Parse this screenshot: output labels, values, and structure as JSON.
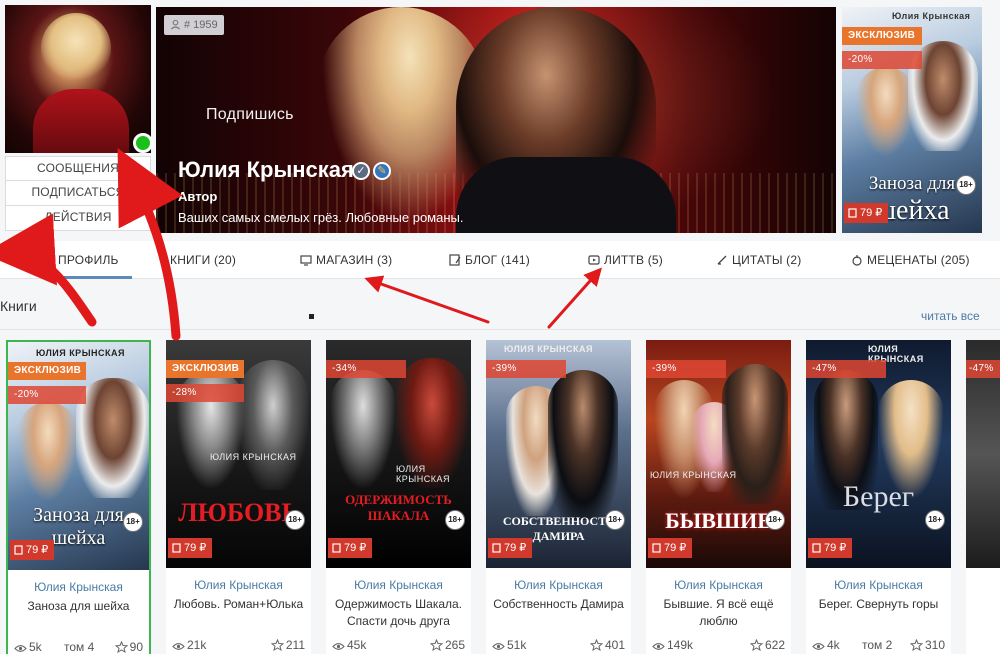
{
  "profile": {
    "member_number": "# 1959",
    "subscribe_overlay": "Подпишись",
    "author_name": "Юлия Крынская",
    "role": "Автор",
    "motto": "Ваших самых смелых грёз. Любовные романы.",
    "buttons": {
      "messages": "СООБЩЕНИЯ",
      "subscribe": "ПОДПИСАТЬСЯ",
      "actions": "ДЕЙСТВИЯ"
    }
  },
  "featured_book": {
    "badge_exclusive": "ЭКСКЛЮЗИВ",
    "discount": "-20%",
    "price": "79 ₽",
    "age": "18+",
    "cover_author": "Юлия Крынская",
    "cover_title_1": "Заноза для",
    "cover_title_2": "шейха"
  },
  "tabs": [
    {
      "label": "ПРОФИЛЬ",
      "icon": "profile-icon"
    },
    {
      "label": "КНИГИ (20)",
      "icon": "book-icon"
    },
    {
      "label": "МАГАЗИН (3)",
      "icon": "shop-icon"
    },
    {
      "label": "БЛОГ (141)",
      "icon": "blog-icon"
    },
    {
      "label": "ЛИТТВ (5)",
      "icon": "video-icon"
    },
    {
      "label": "ЦИТАТЫ (2)",
      "icon": "quote-icon"
    },
    {
      "label": "МЕЦЕНАТЫ (205)",
      "icon": "patron-icon"
    }
  ],
  "books_section": {
    "title": "Книги",
    "read_all": "читать все"
  },
  "books": [
    {
      "author": "Юлия Крынская",
      "title": "Заноза для шейха",
      "badge": "ЭКСКЛЮЗИВ",
      "discount": "-20%",
      "price": "79 ₽",
      "age": "18+",
      "views": "5k",
      "volume": "том 4",
      "rating": "90",
      "cover_text": "Заноза для шейха",
      "cover_author": "ЮЛИЯ КРЫНСКАЯ"
    },
    {
      "author": "Юлия Крынская",
      "title": "Любовь. Роман+Юлька",
      "badge": "ЭКСКЛЮЗИВ",
      "discount": "-28%",
      "price": "79 ₽",
      "age": "18+",
      "views": "21k",
      "volume": "",
      "rating": "211",
      "cover_text": "ЛЮБОВЬ",
      "cover_author": "ЮЛИЯ КРЫНСКАЯ"
    },
    {
      "author": "Юлия Крынская",
      "title": "Одержимость Шакала. Спасти дочь друга",
      "badge": "",
      "discount": "-34%",
      "price": "79 ₽",
      "age": "18+",
      "views": "45k",
      "volume": "",
      "rating": "265",
      "cover_text": "ОДЕРЖИМОСТЬ ШАКАЛА",
      "cover_author": "ЮЛИЯ КРЫНСКАЯ"
    },
    {
      "author": "Юлия Крынская",
      "title": "Собственность Дамира",
      "badge": "",
      "discount": "-39%",
      "price": "79 ₽",
      "age": "18+",
      "views": "51k",
      "volume": "",
      "rating": "401",
      "cover_text": "СОБСТВЕННОСТЬ ДАМИРА",
      "cover_author": "ЮЛИЯ КРЫНСКАЯ"
    },
    {
      "author": "Юлия Крынская",
      "title": "Бывшие. Я всё ещё люблю",
      "badge": "",
      "discount": "-39%",
      "price": "79 ₽",
      "age": "18+",
      "views": "149k",
      "volume": "",
      "rating": "622",
      "cover_text": "БЫВШИЕ",
      "cover_author": "ЮЛИЯ КРЫНСКАЯ"
    },
    {
      "author": "Юлия Крынская",
      "title": "Берег. Свернуть горы",
      "badge": "",
      "discount": "-47%",
      "price": "79 ₽",
      "age": "18+",
      "views": "4k",
      "volume": "том 2",
      "rating": "310",
      "cover_text": "Берег",
      "cover_author": "ЮЛИЯ КРЫНСКАЯ"
    },
    {
      "author": "",
      "title": "",
      "badge": "",
      "discount": "-47%",
      "price": "",
      "age": "",
      "views": "",
      "volume": "",
      "rating": "",
      "cover_text": "",
      "cover_author": ""
    }
  ],
  "colors": {
    "accent_link": "#4a7ba7",
    "exclusive_badge": "#e9742b",
    "discount_badge": "#de4632",
    "price_badge": "#d0392b",
    "online": "#1bc11b",
    "annotation_arrows": "#e0191a"
  }
}
